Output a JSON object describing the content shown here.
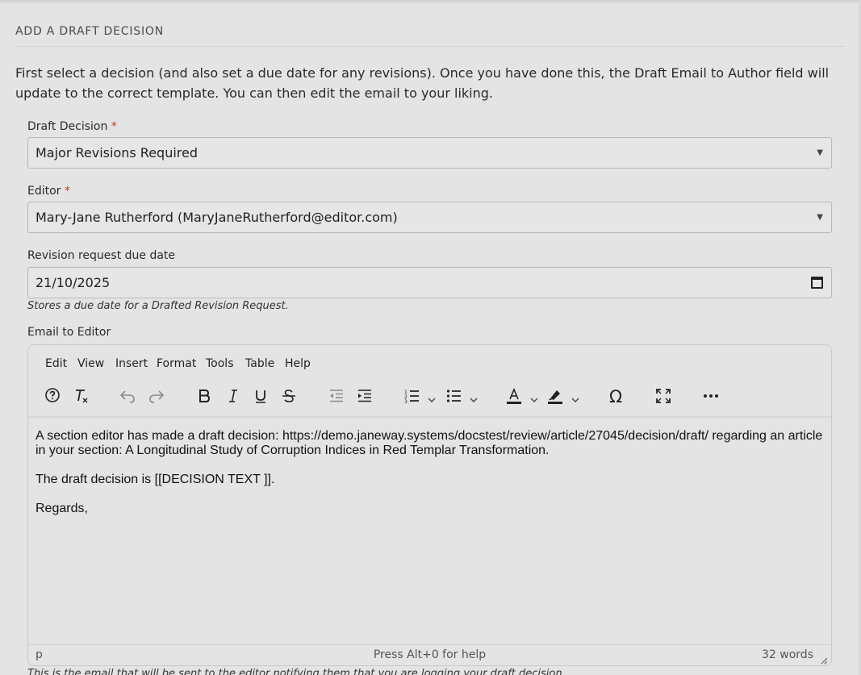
{
  "section": {
    "title": "ADD A DRAFT DECISION",
    "intro": "First select a decision (and also set a due date for any revisions). Once you have done this, the Draft Email to Author field will update to the correct template. You can then edit the email to your liking."
  },
  "fields": {
    "decision": {
      "label": "Draft Decision",
      "required": "*",
      "value": "Major Revisions Required"
    },
    "editor": {
      "label": "Editor",
      "required": "*",
      "value": "Mary-Jane Rutherford (MaryJaneRutherford@editor.com)"
    },
    "due_date": {
      "label": "Revision request due date",
      "value": "21/10/2025",
      "help": "Stores a due date for a Drafted Revision Request."
    },
    "email": {
      "label": "Email to Editor",
      "help": "This is the email that will be sent to the editor notifying them that you are logging your draft decision."
    }
  },
  "rte": {
    "menu": [
      "Edit",
      "View",
      "Insert",
      "Format",
      "Tools",
      "Table",
      "Help"
    ],
    "paragraphs": [
      "A section editor has made a draft decision: https://demo.janeway.systems/docstest/review/article/27045/decision/draft/ regarding an article in your section: A Longitudinal Study of Corruption Indices in Red Templar Transformation.",
      "The draft decision is [[DECISION TEXT ]].",
      "Regards,"
    ],
    "status": {
      "path": "p",
      "help": "Press Alt+0 for help",
      "words": "32 words"
    },
    "icons": {
      "omega": "Ω"
    }
  }
}
